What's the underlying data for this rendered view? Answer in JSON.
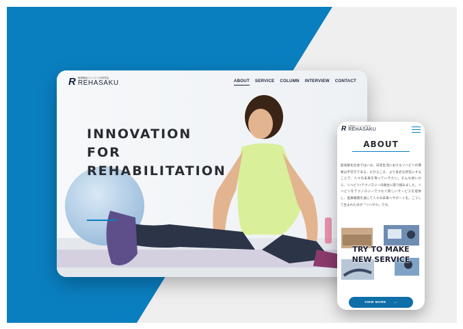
{
  "desktop": {
    "logo_mark": "R",
    "logo_tagline": "医療福祉×リハビリの研究会",
    "logo_name": "REHASAKU",
    "nav": [
      "ABOUT",
      "SERVICE",
      "COLUMN",
      "INTERVIEW",
      "CONTACT"
    ],
    "hero_lines": [
      "INNOVATION",
      "FOR",
      "REHABILITATION"
    ]
  },
  "mobile": {
    "logo_mark": "R",
    "logo_tagline": "医療福祉×リハビリの研究会",
    "logo_name": "REHASAKU",
    "section_title": "ABOUT",
    "body": "超高齢化社会ではいま、日常生活におけるリハビリの需要は不可欠である。だからこそ、より身近な存在にすることで、人々の未来を救っていきたい。そんな想いから、リハビリ×テクノロジーの融合に取り組みました。リハビリをテクノロジーでつなぐ新しいサービスを提供し、医療機関を通じて人々の未来へサポートを。こうして生まれたのが「リハサク」です。",
    "try_lines": [
      "TRY TO MAKE",
      "NEW SERVICE"
    ],
    "view_more": "VIEW MORE",
    "arrow": "→"
  },
  "colors": {
    "accent": "#0a7fc0",
    "button": "#0f6fa8",
    "text_dark": "#2a2c33"
  },
  "icons": {
    "menu": "hamburger-menu-icon",
    "arrow": "arrow-right-icon"
  }
}
